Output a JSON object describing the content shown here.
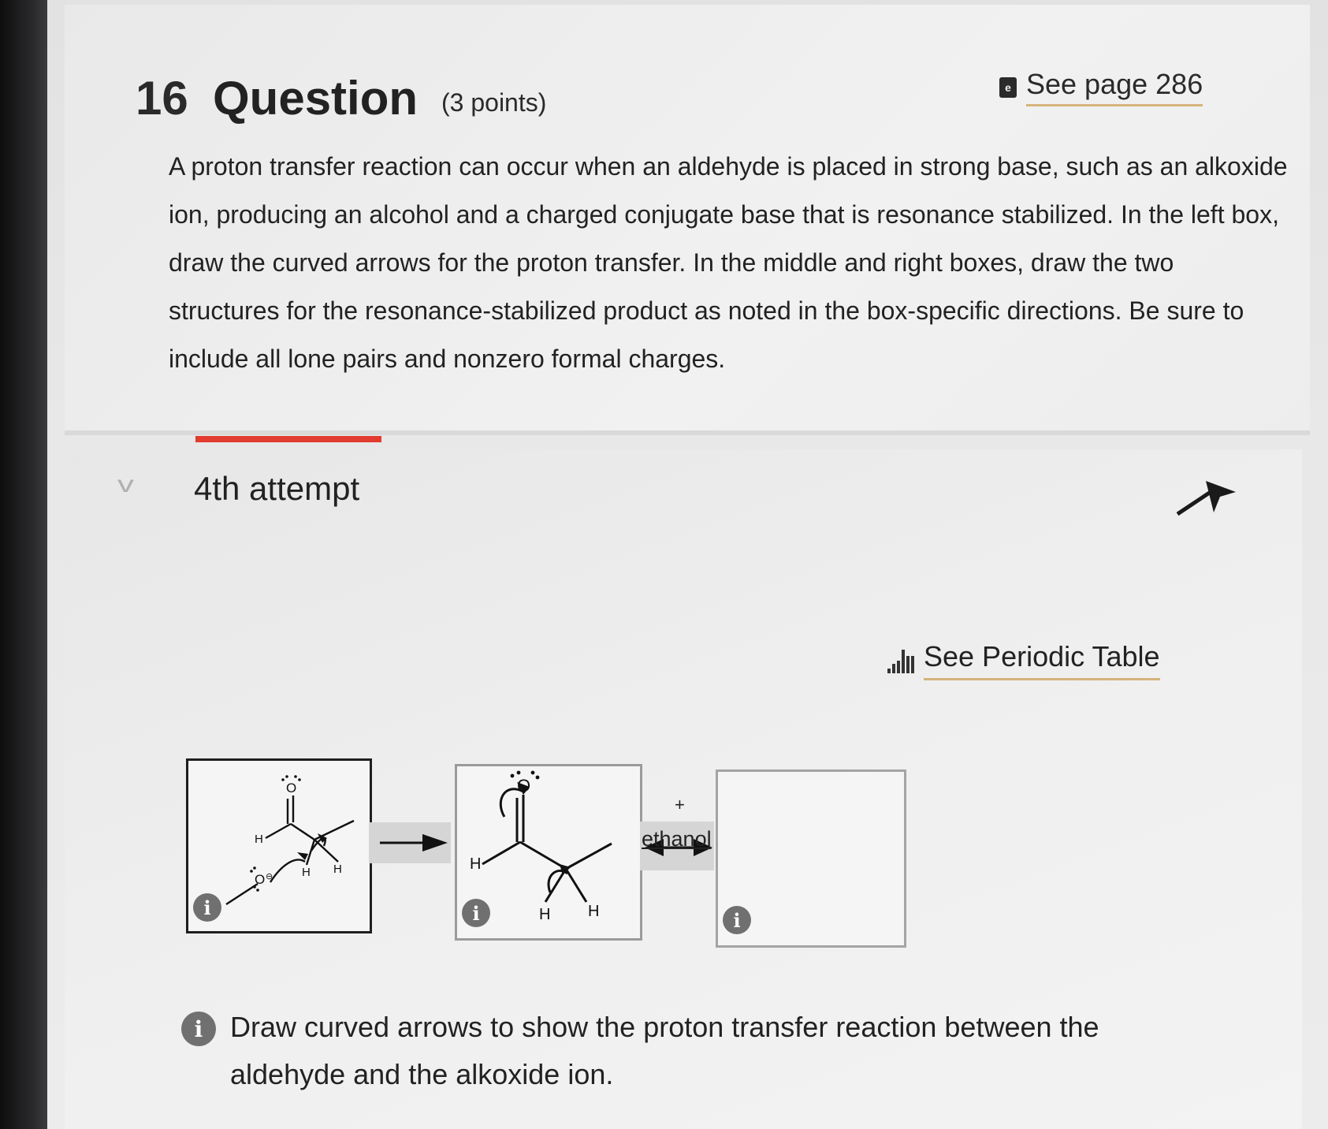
{
  "question": {
    "number": "16",
    "label": "Question",
    "points": "(3 points)",
    "see_page": "See page 286",
    "prompt": "A proton transfer reaction can occur when an aldehyde is placed in strong base, such as an alkoxide ion, producing an alcohol and a charged conjugate base that is resonance stabilized. In the left box, draw the curved arrows for the proton transfer. In the middle and right boxes, draw the two structures for the resonance-stabilized product as noted in the box-specific directions. Be sure to include all lone pairs and nonzero formal charges."
  },
  "attempt": {
    "label": "4th attempt"
  },
  "tools": {
    "periodic_table": "See Periodic Table"
  },
  "drawing": {
    "left_box": {
      "oxygen": "O",
      "h_aldehyde": "H",
      "h_alpha": "H",
      "h_methyl": "H",
      "alkoxide_oxygen": "O",
      "charge": "⊖"
    },
    "middle_box": {
      "oxygen": "O",
      "h_aldehyde": "H",
      "h_alpha_1": "H",
      "h_alpha_2": "H"
    },
    "plus": "+",
    "ethanol": "ethanol"
  },
  "hint": {
    "text": "Draw curved arrows to show the proton transfer reaction between the aldehyde and the alkoxide ion."
  },
  "colors": {
    "accent_red": "#e23b30",
    "link_underline": "#d6b37c",
    "info_icon": "#707070"
  }
}
